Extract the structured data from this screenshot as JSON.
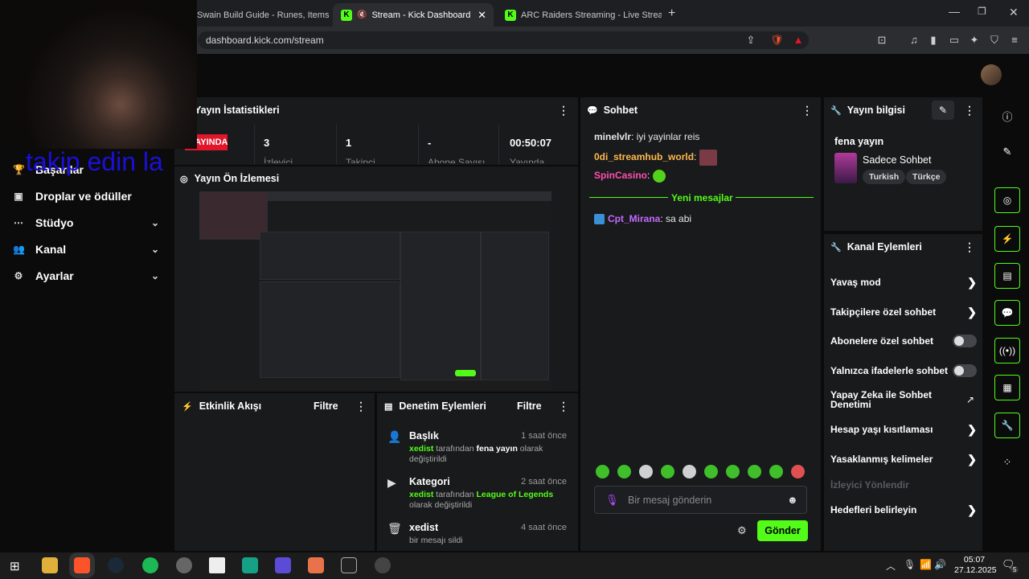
{
  "browser": {
    "tabs": [
      {
        "label": "Swain Build Guide - Runes, Items & M"
      },
      {
        "label": "Stream - Kick Dashboard"
      },
      {
        "label": "ARC Raiders Streaming - Live Stream"
      }
    ],
    "url": "dashboard.kick.com/stream"
  },
  "overlay": {
    "text": "takip edin la"
  },
  "sidebar": {
    "items": [
      {
        "label": "Başarılar"
      },
      {
        "label": "Droplar ve ödüller"
      },
      {
        "label": "Stüdyo"
      },
      {
        "label": "Kanal"
      },
      {
        "label": "Ayarlar"
      }
    ]
  },
  "stats": {
    "title": "Yayın İstatistikleri",
    "live_badge": "YAYINDA",
    "items": [
      {
        "value": "3",
        "label": "İzleyici"
      },
      {
        "value": "1",
        "label": "Takipçi"
      },
      {
        "value": "-",
        "label": "Abone Sayısı"
      },
      {
        "value": "00:50:07",
        "label": "Yayında"
      }
    ]
  },
  "preview": {
    "title": "Yayın Ön İzlemesi"
  },
  "activity": {
    "title": "Etkinlik Akışı",
    "filter": "Filtre"
  },
  "moderation": {
    "title": "Denetim Eylemleri",
    "filter": "Filtre",
    "items": [
      {
        "title": "Başlık",
        "time": "1 saat önce",
        "user": "xedist",
        "pre": "tarafından",
        "value": "fena yayın",
        "post": "olarak değiştirildi"
      },
      {
        "title": "Kategori",
        "time": "2 saat önce",
        "user": "xedist",
        "pre": "tarafından",
        "value": "League of Legends",
        "post": "olarak değiştirildi"
      },
      {
        "title": "xedist",
        "time": "4 saat önce",
        "desc": "bir mesajı sildi"
      }
    ]
  },
  "chat": {
    "title": "Sohbet",
    "messages": [
      {
        "user": "minelvlr",
        "text": "iyi yayinlar reis",
        "color": "#e8e8e8"
      },
      {
        "user": "0di_streamhub_world",
        "text": "",
        "color": "#ffb84d"
      },
      {
        "user": "SpinCasino",
        "text": "",
        "color": "#ff4fb0"
      }
    ],
    "divider": "Yeni mesajlar",
    "new_message": {
      "user": "Cpt_Mirana",
      "text": "sa abi",
      "color": "#c36bff"
    },
    "placeholder": "Bir mesaj gönderin",
    "send": "Gönder"
  },
  "stream_info": {
    "title": "Yayın bilgisi",
    "stream_title": "fena yayın",
    "category": "Sadece Sohbet",
    "tags": [
      "Turkish",
      "Türkçe"
    ]
  },
  "channel_actions": {
    "title": "Kanal Eylemleri",
    "items": [
      {
        "label": "Yavaş mod",
        "control": "arrow"
      },
      {
        "label": "Takipçilere özel sohbet",
        "control": "arrow"
      },
      {
        "label": "Abonelere özel sohbet",
        "control": "toggle"
      },
      {
        "label": "Yalnızca ifadelerle sohbet",
        "control": "toggle"
      },
      {
        "label": "Yapay Zeka ile Sohbet Denetimi",
        "control": "external"
      },
      {
        "label": "Hesap yaşı kısıtlaması",
        "control": "arrow"
      },
      {
        "label": "Yasaklanmış kelimeler",
        "control": "arrow"
      },
      {
        "label": "İzleyici Yönlendir",
        "control": "disabled"
      },
      {
        "label": "Hedefleri belirleyin",
        "control": "arrow"
      }
    ]
  },
  "taskbar": {
    "time": "05:07",
    "date": "27.12.2025",
    "notifications": "5"
  },
  "colors": {
    "accent": "#53fc18",
    "live": "#e0162b",
    "panel": "#191a1c",
    "background": "#0b0b0c"
  }
}
